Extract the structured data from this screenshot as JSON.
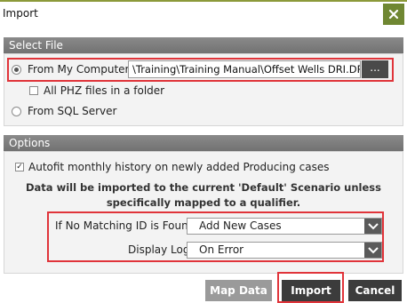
{
  "dialog": {
    "title": "Import",
    "close_icon": "close-x-icon",
    "accent_color": "#6f8732"
  },
  "select_file": {
    "header": "Select File",
    "from_computer_label": "From My Computer",
    "from_computer_selected": true,
    "file_path": "\\Training\\Training Manual\\Offset Wells DRI.DRI",
    "browse_label": "...",
    "all_phz_label": "All PHZ files in a folder",
    "all_phz_checked": false,
    "from_sql_label": "From SQL Server",
    "from_sql_selected": false
  },
  "options": {
    "header": "Options",
    "autofit_label": "Autofit monthly history on newly added Producing cases",
    "autofit_checked": true,
    "info_line1": "Data will be imported to the current 'Default' Scenario unless",
    "info_line2": "specifically mapped to a qualifier.",
    "no_match_label": "If No Matching ID is Found",
    "no_match_value": "Add New Cases",
    "display_log_label": "Display Log",
    "display_log_value": "On Error"
  },
  "buttons": {
    "map_data": "Map Data",
    "import": "Import",
    "cancel": "Cancel"
  },
  "highlight_color": "#e0343a"
}
